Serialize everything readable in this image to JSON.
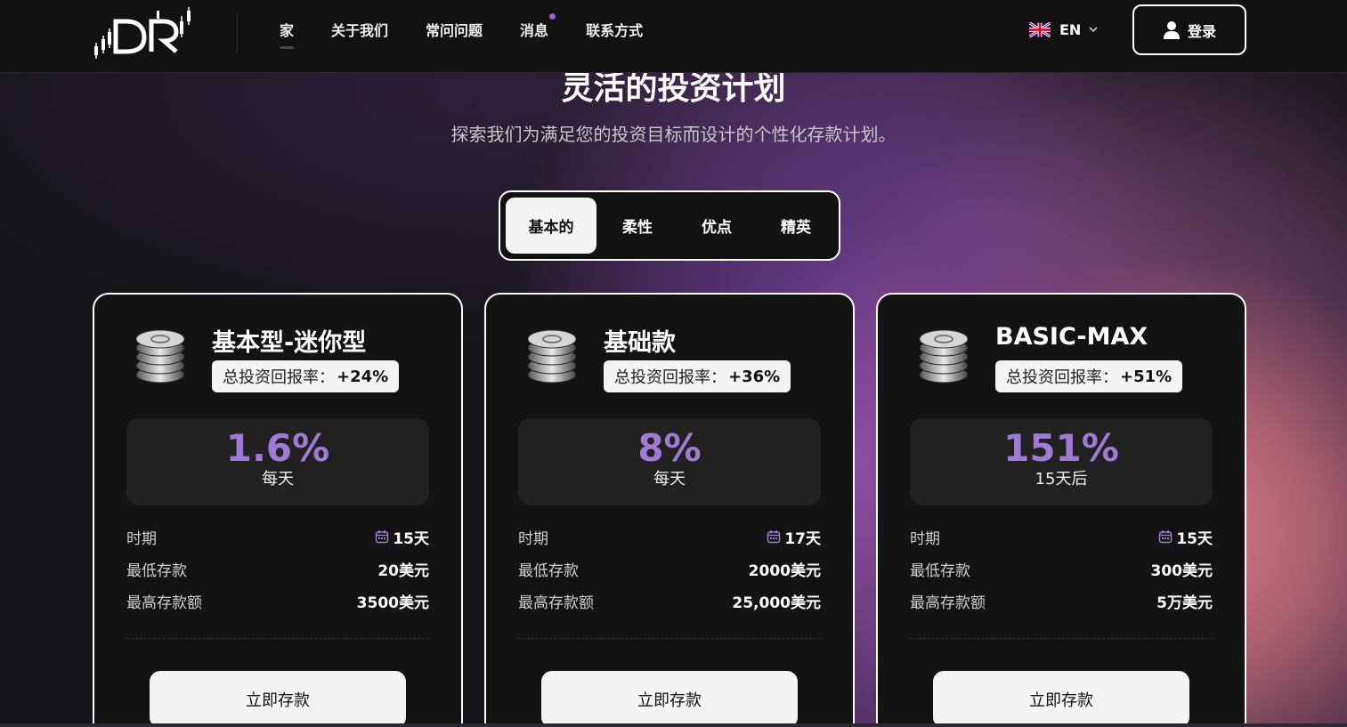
{
  "header": {
    "nav": [
      {
        "label": "家"
      },
      {
        "label": "关于我们"
      },
      {
        "label": "常问问题"
      },
      {
        "label": "消息"
      },
      {
        "label": "联系方式"
      }
    ],
    "lang": {
      "code": "EN",
      "flag_icon": "uk-flag-icon"
    },
    "login_label": "登录"
  },
  "hero": {
    "title": "灵活的投资计划",
    "subtitle": "探索我们为满足您的投资目标而设计的个性化存款计划。"
  },
  "tabs": [
    {
      "label": "基本的",
      "active": true
    },
    {
      "label": "柔性",
      "active": false
    },
    {
      "label": "优点",
      "active": false
    },
    {
      "label": "精英",
      "active": false
    }
  ],
  "plans": [
    {
      "name": "基本型-迷你型",
      "roi_label": "总投资回报率：",
      "roi_value": "+24%",
      "rate": "1.6%",
      "rate_unit": "每天",
      "period_label": "时期",
      "period_value": "15天",
      "min_label": "最低存款",
      "min_value": "20美元",
      "max_label": "最高存款额",
      "max_value": "3500美元",
      "button_label": "立即存款"
    },
    {
      "name": "基础款",
      "roi_label": "总投资回报率：",
      "roi_value": "+36%",
      "rate": "8%",
      "rate_unit": "每天",
      "period_label": "时期",
      "period_value": "17天",
      "min_label": "最低存款",
      "min_value": "2000美元",
      "max_label": "最高存款额",
      "max_value": "25,000美元",
      "button_label": "立即存款"
    },
    {
      "name": "BASIC-MAX",
      "roi_label": "总投资回报率：",
      "roi_value": "+51%",
      "rate": "151%",
      "rate_unit": "15天后",
      "period_label": "时期",
      "period_value": "15天",
      "min_label": "最低存款",
      "min_value": "300美元",
      "max_label": "最高存款额",
      "max_value": "5万美元",
      "button_label": "立即存款"
    }
  ],
  "colors": {
    "accent": "#a07bd6",
    "notification_dot": "#8c65d3",
    "background": "#161418"
  }
}
